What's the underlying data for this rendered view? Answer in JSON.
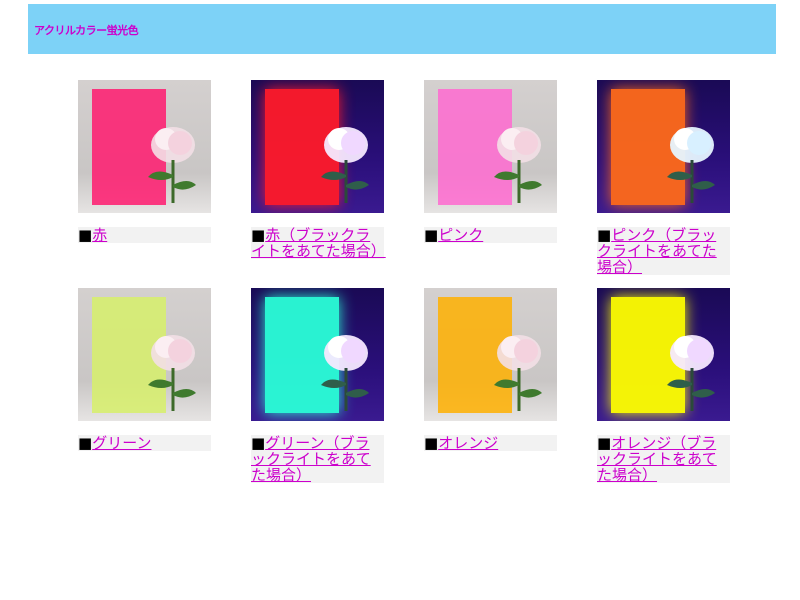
{
  "header": {
    "title": "アクリルカラー蛍光色"
  },
  "items": [
    {
      "label": "赤",
      "panel_color": "#ff1a6e",
      "bg": "gray"
    },
    {
      "label": "赤（ブラックライトをあてた場合）",
      "panel_color": "#ff1a2a",
      "bg": "dark"
    },
    {
      "label": "ピンク",
      "panel_color": "#ff6ad0",
      "bg": "gray"
    },
    {
      "label": "ピンク（ブラックライトをあてた場合）",
      "panel_color": "#ff6a1a",
      "bg": "dark"
    },
    {
      "label": "グリーン",
      "panel_color": "#d7f06a",
      "bg": "gray"
    },
    {
      "label": "グリーン（ブラックライトをあてた場合）",
      "panel_color": "#2affd8",
      "bg": "dark"
    },
    {
      "label": "オレンジ",
      "panel_color": "#ffb000",
      "bg": "gray"
    },
    {
      "label": "オレンジ（ブラックライトをあてた場合）",
      "panel_color": "#ffff00",
      "bg": "dark"
    }
  ],
  "bullet": "■",
  "icons": {
    "photo": "rose-acrylic-photo",
    "bullet": "black-square"
  },
  "colors": {
    "header_bg": "#7dd2f7",
    "link": "#cc00cc",
    "caption_bg": "#f2f2f2"
  }
}
